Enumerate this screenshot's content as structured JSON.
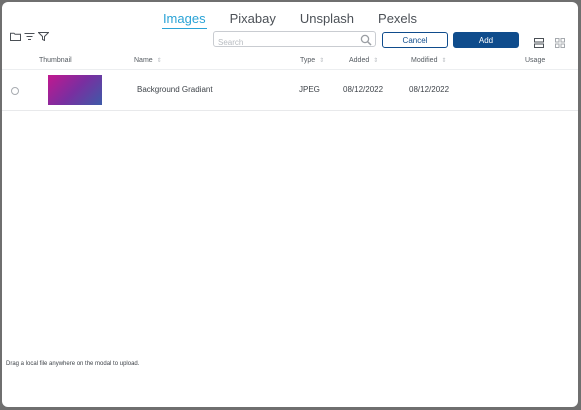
{
  "tabs": [
    {
      "label": "Images",
      "active": true
    },
    {
      "label": "Pixabay",
      "active": false
    },
    {
      "label": "Unsplash",
      "active": false
    },
    {
      "label": "Pexels",
      "active": false
    }
  ],
  "toolbar": {
    "icons": [
      "folder-icon",
      "sort-lines-icon",
      "filter-icon"
    ],
    "search_placeholder": "Search",
    "search_value": "",
    "cancel_label": "Cancel",
    "add_label": "Add",
    "view_icons": [
      "list-view-icon",
      "grid-view-icon"
    ]
  },
  "table": {
    "columns": [
      "Thumbnail",
      "Name",
      "Type",
      "Added",
      "Modified",
      "Usage"
    ],
    "rows": [
      {
        "name": "Background Gradiant",
        "type": "JPEG",
        "added": "08/12/2022",
        "modified": "08/12/2022",
        "usage": ""
      }
    ]
  },
  "footer": {
    "hint": "Drag a local file anywhere on the modal to upload."
  },
  "colors": {
    "accent": "#2aa3d6",
    "primary": "#0f4c8c",
    "overlay": "#6f6f6f"
  }
}
